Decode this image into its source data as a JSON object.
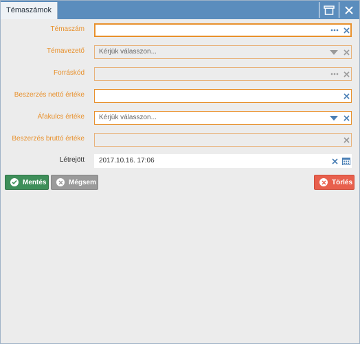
{
  "window": {
    "title": "Témaszámok"
  },
  "fields": [
    {
      "label": "Témaszám",
      "value": ""
    },
    {
      "label": "Témavezető",
      "placeholder": "Kérjük válasszon..."
    },
    {
      "label": "Forráskód",
      "value": ""
    },
    {
      "label": "Beszerzés nettó értéke",
      "value": ""
    },
    {
      "label": "Áfakulcs értéke",
      "placeholder": "Kérjük válasszon..."
    },
    {
      "label": "Beszerzés bruttó értéke",
      "value": ""
    },
    {
      "label": "Létrejött",
      "value": "2017.10.16. 17:06"
    }
  ],
  "buttons": {
    "save": "Mentés",
    "cancel": "Mégsem",
    "delete": "Törlés"
  },
  "colors": {
    "title_bar": "#5b8dbd",
    "required_label": "#e8902b",
    "save": "#3f8f5a",
    "cancel": "#9a9a9a",
    "delete": "#e8604d"
  }
}
